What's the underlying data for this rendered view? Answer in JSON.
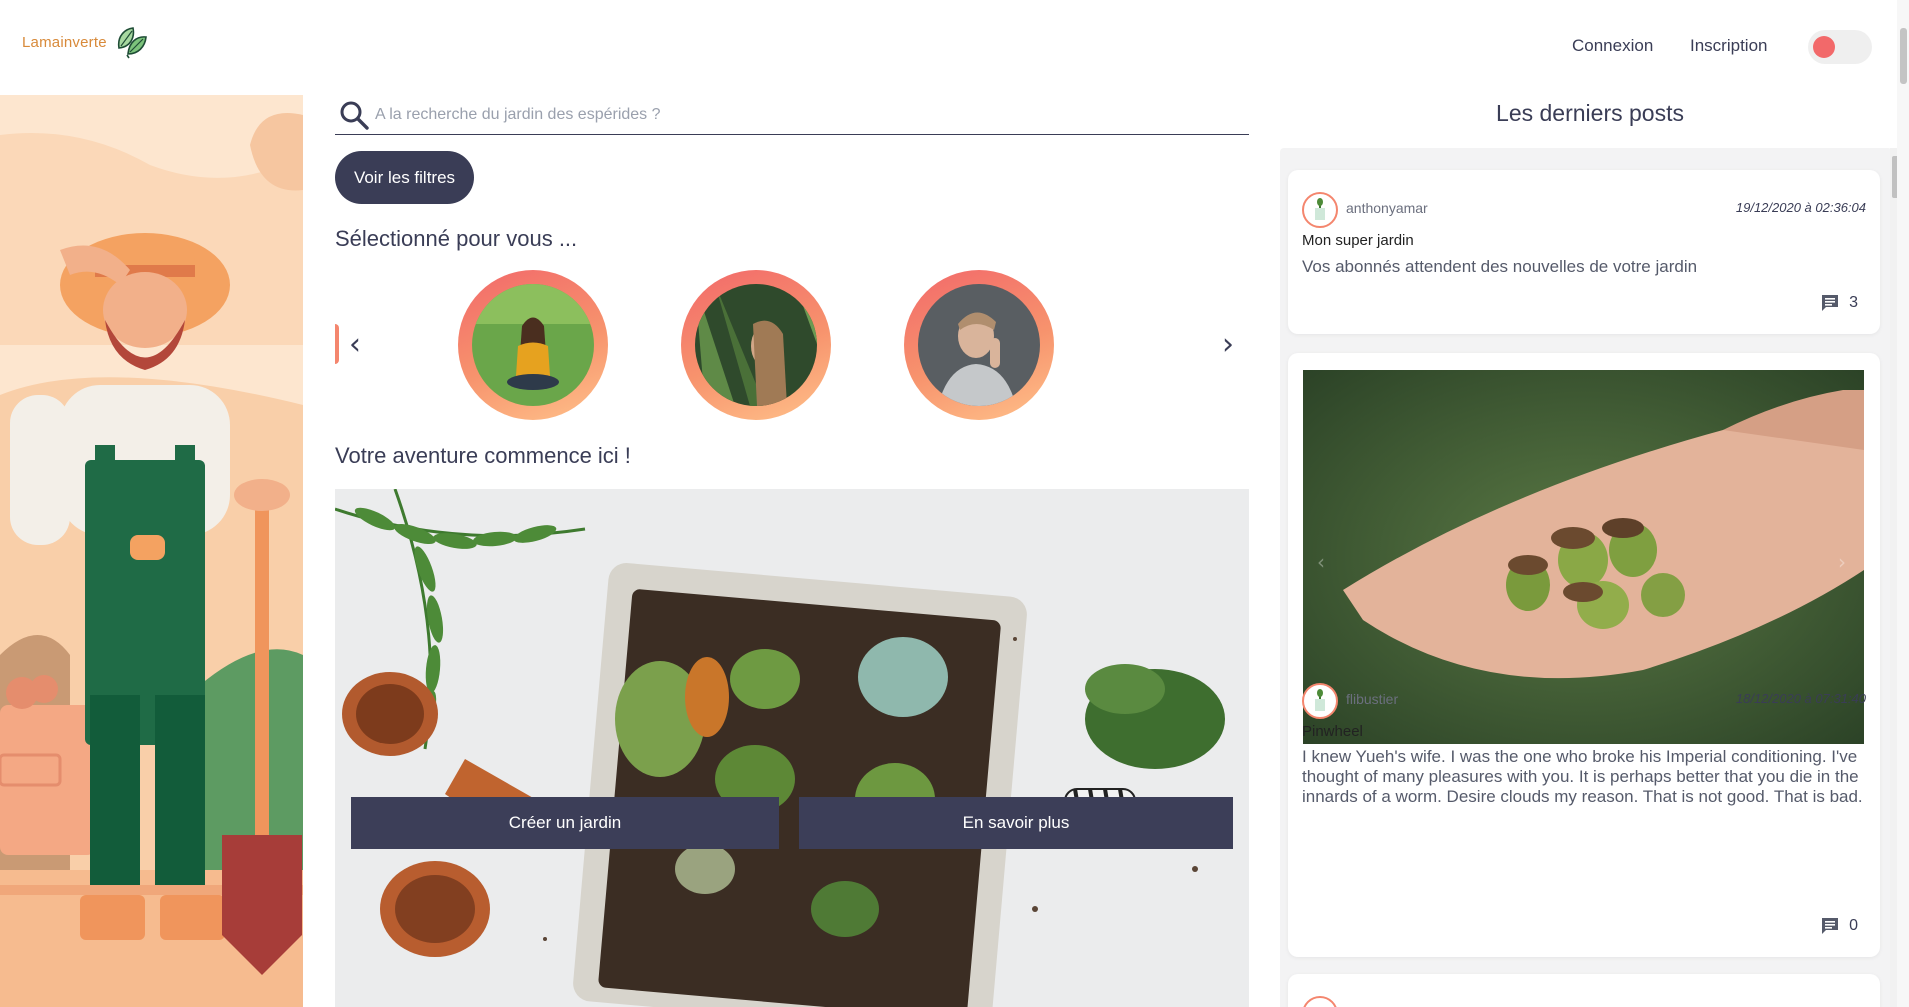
{
  "header": {
    "logo_text": "Lamainverte",
    "nav_login": "Connexion",
    "nav_register": "Inscription",
    "theme_toggle_color": "#f2696a"
  },
  "search": {
    "placeholder": "A la recherche du jardin des espérides ?",
    "icon": "search-icon"
  },
  "filters": {
    "button_label": "Voir les filtres"
  },
  "selection": {
    "title": "Sélectionné pour vous ...",
    "prev_arrow": "‹",
    "next_arrow": "›"
  },
  "adventure": {
    "title": "Votre aventure commence ici !",
    "create_button": "Créer un jardin",
    "more_button": "En savoir plus"
  },
  "posts": {
    "title": "Les derniers posts",
    "items": [
      {
        "user": "anthonyamar",
        "date": "19/12/2020 à 02:36:04",
        "title": "Mon super jardin",
        "body": "Vos abonnés attendent des nouvelles de votre jardin",
        "comments": "3"
      },
      {
        "user": "flibustier",
        "date": "18/12/2020 à 07:31:40",
        "title": "Pinwheel",
        "body": "I knew Yueh's wife. I was the one who broke his Imperial conditioning. I've thought of many pleasures with you. It is perhaps better that you die in the innards of a worm. Desire clouds my reason. That is not good. That is bad.",
        "comments": "0"
      }
    ]
  },
  "colors": {
    "primary": "#3a3d56",
    "accent": "#f2696a",
    "logo": "#d88a3a"
  }
}
